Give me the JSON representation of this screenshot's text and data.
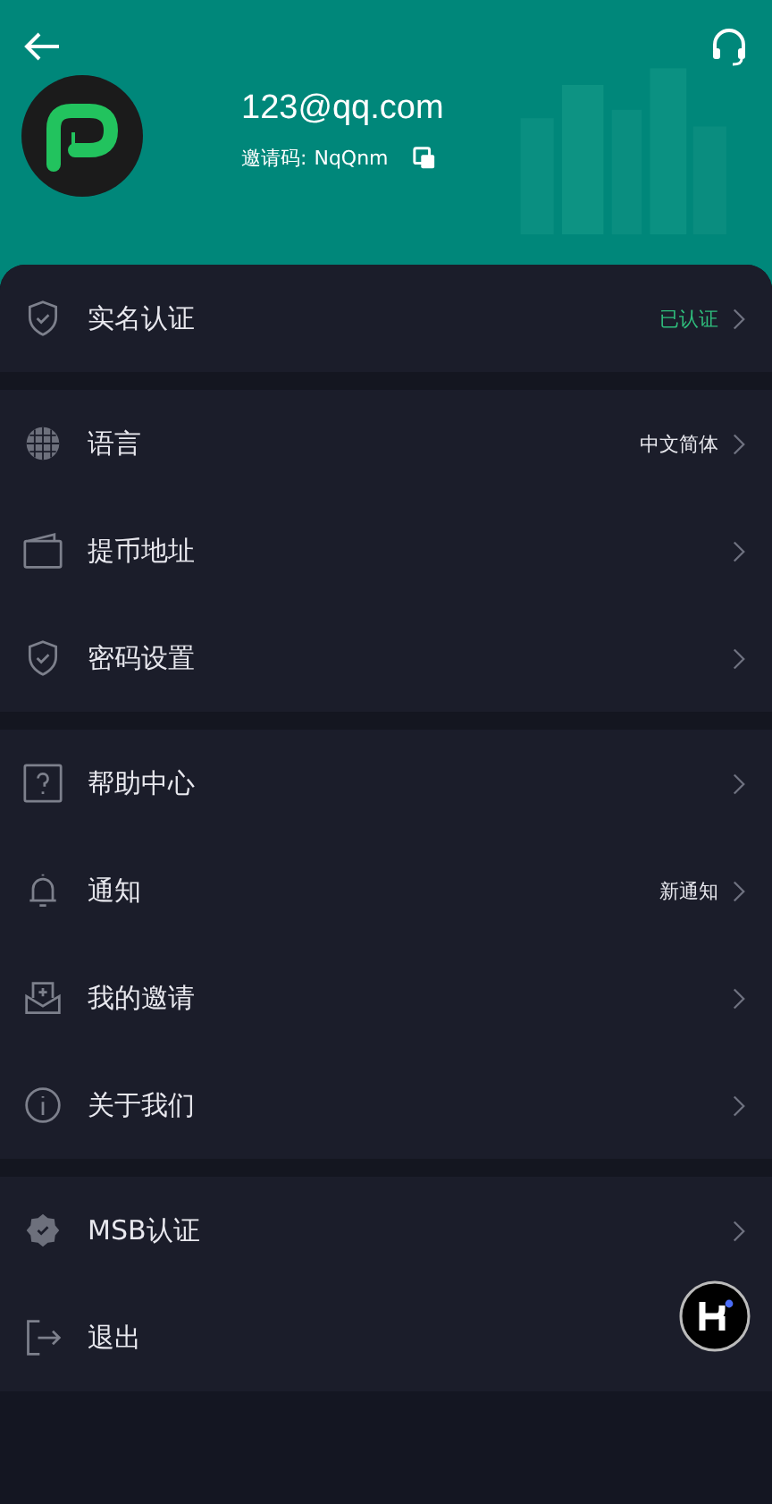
{
  "header": {
    "email": "123@qq.com",
    "invite_label": "邀请码:",
    "invite_code": "NqQnm"
  },
  "groups": [
    {
      "items": [
        {
          "label": "实名认证",
          "value": "已认证",
          "highlight": true,
          "chevron": true
        }
      ]
    },
    {
      "items": [
        {
          "label": "语言",
          "value": "中文简体",
          "highlight": false,
          "chevron": true
        },
        {
          "label": "提币地址",
          "chevron": true
        },
        {
          "label": "密码设置",
          "chevron": true
        }
      ]
    },
    {
      "items": [
        {
          "label": "帮助中心",
          "chevron": true
        },
        {
          "label": "通知",
          "value": "新通知",
          "highlight": false,
          "chevron": true
        },
        {
          "label": "我的邀请",
          "chevron": true
        },
        {
          "label": "关于我们",
          "chevron": true
        }
      ]
    },
    {
      "items": [
        {
          "label": "MSB认证",
          "chevron": true
        },
        {
          "label": "退出",
          "chevron": false
        }
      ]
    }
  ]
}
